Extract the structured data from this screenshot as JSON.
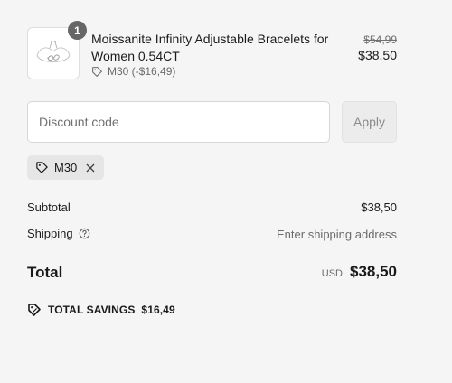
{
  "product": {
    "quantity": "1",
    "name": "Moissanite Infinity Adjustable Bracelets for Women 0.54CT",
    "discount_text": "M30 (-$16,49)",
    "original_price": "$54,99",
    "price": "$38,50",
    "image_icon": "bracelet-image"
  },
  "discount": {
    "placeholder": "Discount code",
    "apply_label": "Apply",
    "applied_code": "M30"
  },
  "summary": {
    "subtotal_label": "Subtotal",
    "subtotal_value": "$38,50",
    "shipping_label": "Shipping",
    "shipping_value": "Enter shipping address",
    "total_label": "Total",
    "currency": "USD",
    "total_value": "$38,50",
    "savings_label": "TOTAL SAVINGS",
    "savings_value": "$16,49"
  },
  "colors": {
    "background": "#f5f5f5",
    "badge": "#666666",
    "chip": "#e6e6e6",
    "apply_button": "#ececec"
  }
}
